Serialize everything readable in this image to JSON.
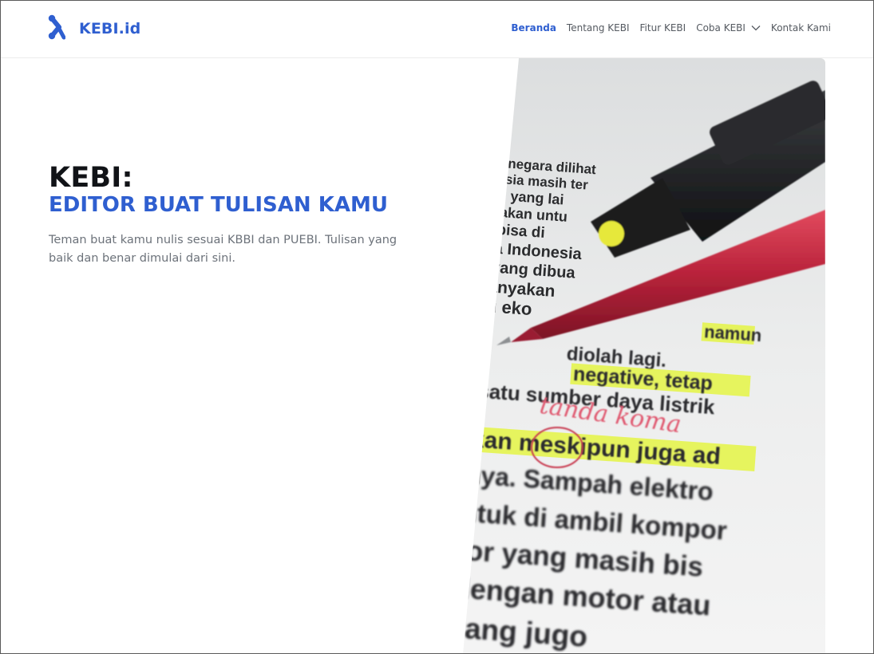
{
  "brand": {
    "name": "KEBI.id",
    "logo_icon": "kebi-x-logo-icon",
    "accent": "#2f5fd0"
  },
  "nav": {
    "items": [
      {
        "label": "Beranda",
        "active": true
      },
      {
        "label": "Tentang KEBI",
        "active": false
      },
      {
        "label": "Fitur KEBI",
        "active": false
      },
      {
        "label": "Coba KEBI",
        "active": false,
        "dropdown_icon": "chevron-down-icon"
      },
      {
        "label": "Kontak Kami",
        "active": false
      }
    ]
  },
  "hero": {
    "title_line1": "KEBI:",
    "title_line2": "EDITOR BUAT TULISAN KAMU",
    "lead": "Teman buat kamu nulis sesuai KBBI dan PUEBI. Tulisan yang baik dan benar dimulai dari sini."
  },
  "photo": {
    "lines": [
      {
        "text": "negara dilihat",
        "highlight": false
      },
      {
        "text": "sia masih ter",
        "highlight": false
      },
      {
        "text": "i yang lai",
        "highlight": false
      },
      {
        "text": "akan untu",
        "highlight": false
      },
      {
        "text": "bisa di",
        "highlight": false
      },
      {
        "text": "a Indonesia",
        "highlight": false
      },
      {
        "text": "yang dibua",
        "highlight": false
      },
      {
        "text": "anyakan",
        "highlight": false
      },
      {
        "text": "ri eko",
        "highlight": false
      },
      {
        "text": "namun",
        "highlight": true
      },
      {
        "text": "diolah lagi.",
        "highlight": false
      },
      {
        "text": "negative, tetap",
        "highlight": true
      },
      {
        "text": "satu sumber daya listrik",
        "highlight": false
      },
      {
        "text": "kan meskipun juga ad",
        "highlight": true
      },
      {
        "text": "nya. Sampah elektro",
        "highlight": false
      },
      {
        "text": "ntuk di ambil kompor",
        "highlight": false
      },
      {
        "text": "tor yang masih bis",
        "highlight": false
      },
      {
        "text": "dengan motor atau",
        "highlight": false
      },
      {
        "text": "yang jugo",
        "highlight": false
      }
    ],
    "annotation": "tanda koma",
    "highlight_color": "#e4f53a",
    "pen_color": "#b8223a",
    "marker_color": "#1c1d1f"
  }
}
